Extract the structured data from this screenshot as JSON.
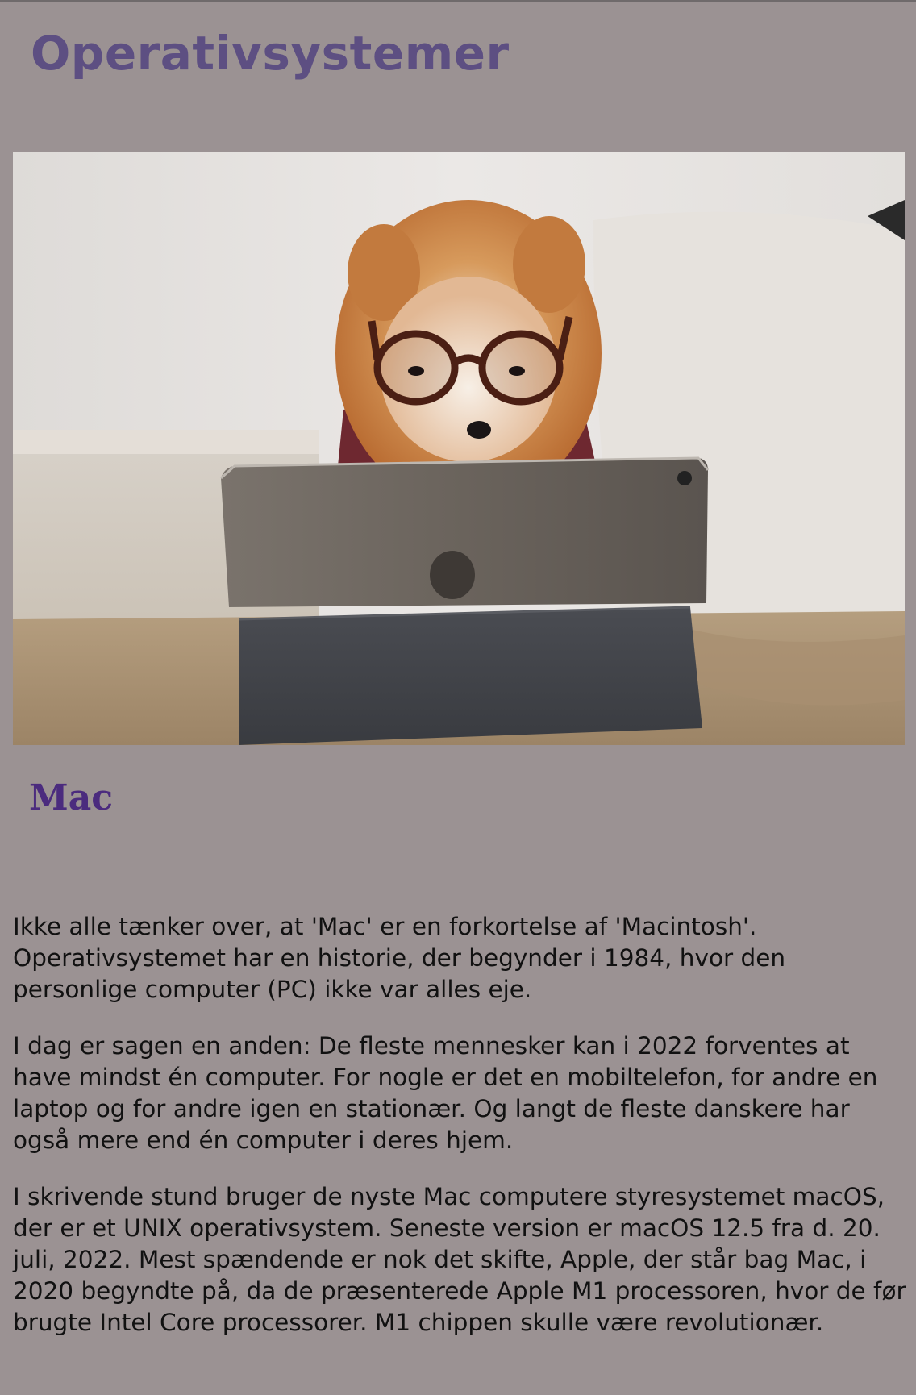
{
  "header": {
    "title": "Operativsystemer"
  },
  "hero_image": {
    "description_icon": "dog-with-glasses-tablet-photo"
  },
  "section": {
    "title": "Mac",
    "paragraphs": [
      "Ikke alle tænker over, at 'Mac' er en forkortelse af 'Macintosh'. Operativsystemet har en historie, der begynder i 1984, hvor den personlige computer (PC) ikke var alles eje.",
      "I dag er sagen en anden: De fleste mennesker kan i 2022 forventes at have mindst én computer. For nogle er det en mobiltelefon, for andre en laptop og for andre igen en stationær. Og langt de fleste danskere har også mere end én computer i deres hjem.",
      "I skrivende stund bruger de nyste Mac computere styresystemet macOS, der er et UNIX operativsystem. Seneste version er macOS 12.5 fra d. 20. juli, 2022. Mest spændende er nok det skifte, Apple, der står bag Mac, i 2020 begyndte på, da de præsenterede Apple M1 processoren, hvor de før brugte Intel Core processorer. M1 chippen skulle være revolutionær."
    ]
  },
  "colors": {
    "background": "#9b9293",
    "title": "#5d4f82",
    "section_title": "#4b2b7e"
  }
}
